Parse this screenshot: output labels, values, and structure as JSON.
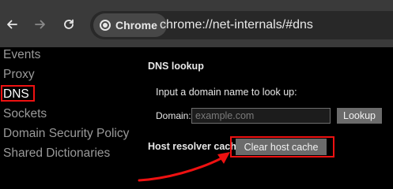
{
  "toolbar": {
    "back_icon": "back-arrow-icon",
    "forward_icon": "forward-arrow-icon",
    "reload_icon": "reload-icon",
    "chip_label": "Chrome",
    "url": "chrome://net-internals/#dns"
  },
  "sidebar": {
    "items": [
      {
        "label": "Events"
      },
      {
        "label": "Proxy"
      },
      {
        "label": "DNS"
      },
      {
        "label": "Sockets"
      },
      {
        "label": "Domain Security Policy"
      },
      {
        "label": "Shared Dictionaries"
      }
    ],
    "active_index": 2
  },
  "dns": {
    "heading": "DNS lookup",
    "prompt": "Input a domain name to look up:",
    "domain_label": "Domain:",
    "domain_placeholder": "example.com",
    "domain_value": "",
    "lookup_label": "Lookup",
    "cache_heading": "Host resolver cache",
    "clear_label": "Clear host cache"
  },
  "colors": {
    "highlight": "#ee1111",
    "toolbar_bg": "#3a3a3a",
    "background": "#000000"
  }
}
